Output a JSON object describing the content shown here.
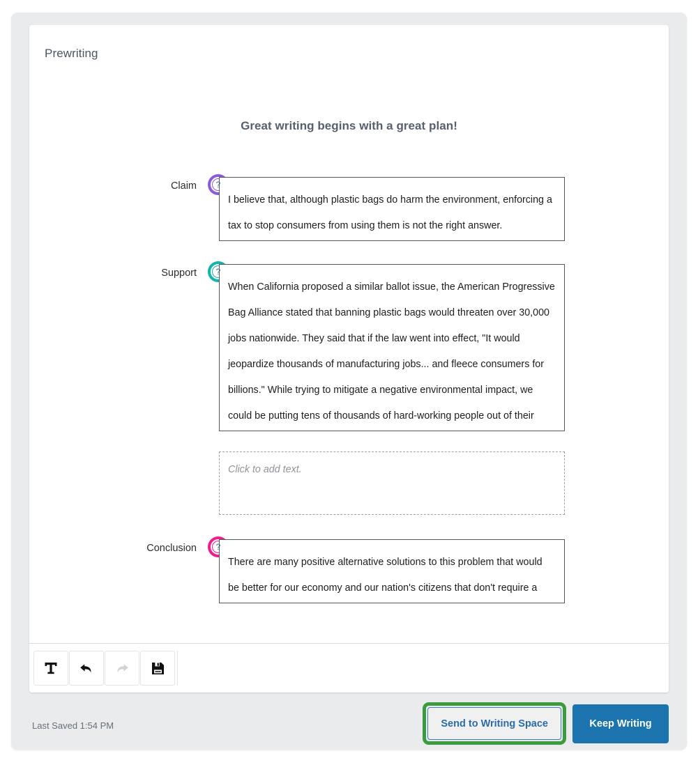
{
  "page": {
    "title": "Prewriting",
    "headline": "Great writing begins with a great plan!"
  },
  "sections": [
    {
      "label": "Claim",
      "icon": "help-question-icon",
      "ring_color": "#8b5cd6",
      "text": "I believe that, although plastic bags do harm the environment, enforcing a tax to stop consumers from using them is not the right answer."
    },
    {
      "label": "Support",
      "icon": "help-question-icon",
      "ring_color": "#14b3ab",
      "text": "When California proposed a similar ballot issue, the American Progressive Bag Alliance stated that banning plastic bags would threaten over 30,000 jobs nationwide. They said that if the law went into effect, \"It would jeopardize thousands of manufacturing jobs... and fleece consumers for billions.\" While trying to mitigate a negative environmental impact, we could be putting tens of thousands of hard-working people out of their jobs."
    },
    {
      "label": "",
      "icon": "",
      "ring_color": "",
      "text": "",
      "placeholder": "Click to add text."
    },
    {
      "label": "Conclusion",
      "icon": "help-question-icon",
      "ring_color": "#ef1e90",
      "text": "There are many positive alternative solutions to this problem that would be better for our economy and our nation's citizens that don't require a tax."
    }
  ],
  "toolbar": {
    "text_tool_label": "T",
    "buttons": [
      {
        "name": "text-tool",
        "icon": "text-format-icon",
        "enabled": true
      },
      {
        "name": "undo",
        "icon": "undo-arrow-icon",
        "enabled": true
      },
      {
        "name": "redo",
        "icon": "redo-arrow-icon",
        "enabled": false
      },
      {
        "name": "save",
        "icon": "floppy-disk-save-icon",
        "enabled": true
      }
    ]
  },
  "footer": {
    "last_saved": "Last Saved 1:54 PM",
    "send_button": "Send to Writing Space",
    "keep_button": "Keep Writing",
    "highlight_color": "#3c9a3f",
    "primary_color": "#1b74ae"
  }
}
